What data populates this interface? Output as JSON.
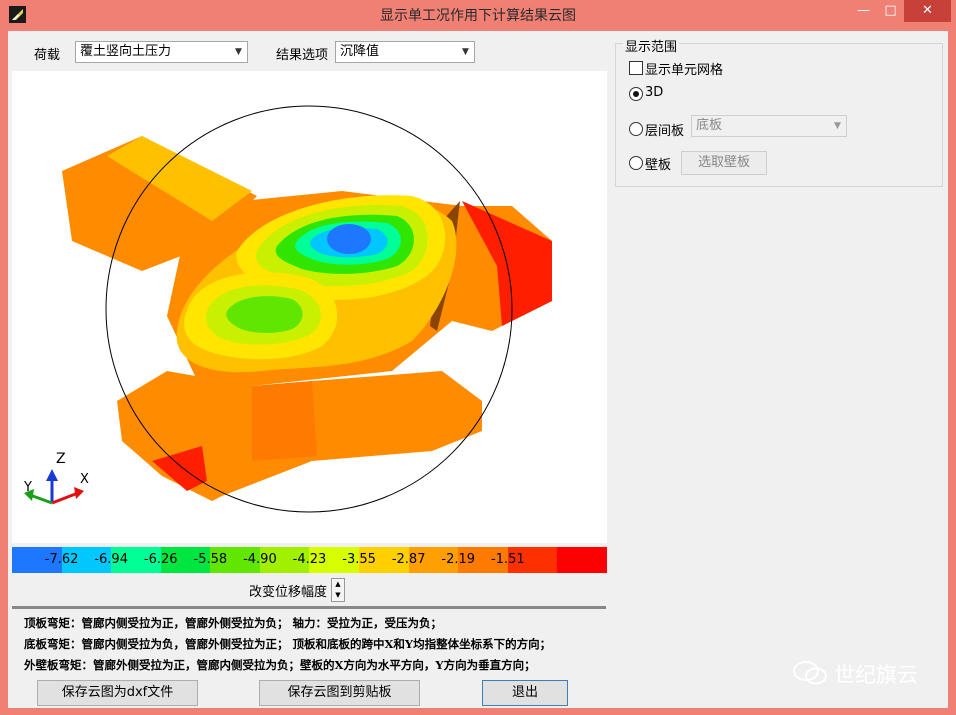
{
  "window": {
    "title": "显示单工况作用下计算结果云图"
  },
  "toolbar": {
    "load_label": "荷载",
    "load_value": "覆土竖向土压力",
    "result_label": "结果选项",
    "result_value": "沉降值"
  },
  "axes": {
    "z": "Z",
    "x": "X",
    "y": "Y"
  },
  "legend": {
    "ticks": [
      "-7.62",
      "-6.94",
      "-6.26",
      "-5.58",
      "-4.90",
      "-4.23",
      "-3.55",
      "-2.87",
      "-2.19",
      "-1.51"
    ],
    "colors": [
      "#1e78ff",
      "#00c8ff",
      "#00ff96",
      "#00e640",
      "#60e600",
      "#a0f000",
      "#d8ff00",
      "#ffd000",
      "#ffa000",
      "#ff7a00",
      "#ff3000",
      "#ff0000"
    ]
  },
  "scale_control": {
    "label": "改变位移幅度"
  },
  "notes": [
    "顶板弯矩：管廊内侧受拉为正，管廊外侧受拉为负；   轴力：受拉为正，受压为负；",
    "底板弯矩：管廊内侧受拉为负，管廊外侧受拉为正；   顶板和底板的跨中X和Y均指整体坐标系下的方向；",
    "外壁板弯矩：管廊外侧受拉为正，管廊内侧受拉为负；壁板的X方向为水平方向，Y方向为垂直方向；"
  ],
  "buttons": {
    "save_dxf": "保存云图为dxf文件",
    "save_clipboard": "保存云图到剪贴板",
    "exit": "退出"
  },
  "display_range": {
    "title": "显示范围",
    "show_grid": "显示单元网格",
    "opt_3d": "3D",
    "opt_layer": "层间板",
    "layer_value": "底板",
    "opt_wall": "壁板",
    "pick_wall": "选取壁板",
    "selected": "3D"
  },
  "watermark": "世纪旗云"
}
